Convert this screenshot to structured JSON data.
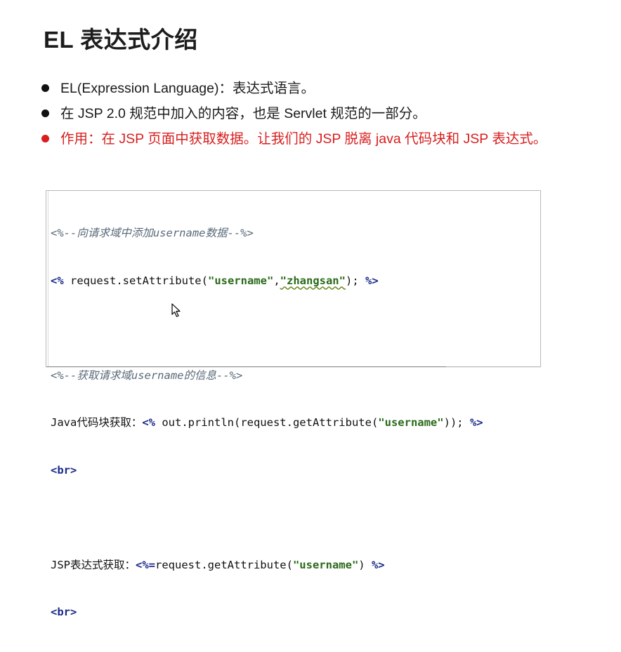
{
  "slide": {
    "title": "EL 表达式介绍"
  },
  "bullets": [
    {
      "text": "EL(Expression Language)：表达式语言。",
      "color": "#111111"
    },
    {
      "text": "在 JSP 2.0 规范中加入的内容，也是 Servlet 规范的一部分。",
      "color": "#111111"
    },
    {
      "text": "作用：在 JSP 页面中获取数据。让我们的 JSP 脱离 java 代码块和 JSP 表达式。",
      "color": "#d81e1e"
    }
  ],
  "code": {
    "line1_comment": "<%--向请求域中添加username数据--%>",
    "line2_open": "<%",
    "line2_text": " request.setAttribute(",
    "line2_str1": "\"username\"",
    "line2_comma": ",",
    "line2_str2": "\"zhangsan\"",
    "line2_end": "); ",
    "line2_close": "%>",
    "line4_comment": "<%--获取请求域username的信息--%>",
    "line5_label": "Java代码块获取：",
    "line5_open": "<%",
    "line5_text": " out.println(request.getAttribute(",
    "line5_str": "\"username\"",
    "line5_end": ")); ",
    "line5_close": "%>",
    "line6_br": "<br>",
    "line8_label": "JSP表达式获取：",
    "line8_open": "<%=",
    "line8_text": "request.getAttribute(",
    "line8_str": "\"username\"",
    "line8_end": ") ",
    "line8_close": "%>",
    "line9_br": "<br>"
  },
  "colors": {
    "accent_red": "#d81e1e",
    "code_tag": "#1a2a8a",
    "code_string": "#2a6a1a",
    "code_comment": "#5a6a7a"
  },
  "icons": {
    "bullet": "filled-circle",
    "cursor": "mouse-pointer-arrow"
  }
}
